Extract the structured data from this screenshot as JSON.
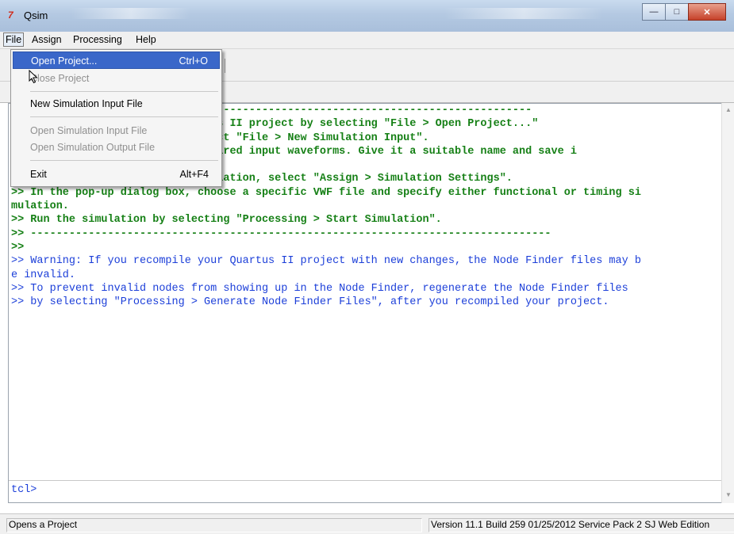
{
  "window": {
    "title": "Qsim",
    "app_icon_glyph": "7",
    "minimize_glyph": "—",
    "maximize_glyph": "□",
    "close_glyph": "✕"
  },
  "menubar": {
    "items": [
      {
        "label": "File"
      },
      {
        "label": "Assign"
      },
      {
        "label": "Processing"
      },
      {
        "label": "Help"
      }
    ]
  },
  "file_menu": {
    "items": [
      {
        "label": "Open Project...",
        "shortcut": "Ctrl+O",
        "state": "highlighted"
      },
      {
        "label": "Close Project",
        "shortcut": "",
        "state": "disabled"
      },
      {
        "label": "New Simulation Input File",
        "shortcut": "",
        "state": "enabled"
      },
      {
        "label": "Open Simulation Input File",
        "shortcut": "",
        "state": "disabled"
      },
      {
        "label": "Open Simulation Output File",
        "shortcut": "",
        "state": "disabled"
      },
      {
        "label": "Exit",
        "shortcut": "Alt+F4",
        "state": "enabled"
      }
    ]
  },
  "console": {
    "lines": [
      {
        "text": "                  ---------------------------------------------------------------",
        "color": "green"
      },
      {
        "text": "                  xisting Quartus II project by selecting \"File > Open Project...\"",
        "color": "green"
      },
      {
        "text": "                  orm file, select \"File > New Simulation Input\".",
        "color": "green"
      },
      {
        "text": "                  create the desired input waveforms. Give it a suitable name and save i",
        "color": "green"
      },
      {
        "text": "",
        "color": "green"
      },
      {
        "text": ">> To specify a setting for simulation, select \"Assign > Simulation Settings\".",
        "color": "green"
      },
      {
        "text": ">> In the pop-up dialog box, choose a specific VWF file and specify either functional or timing si",
        "color": "green"
      },
      {
        "text": "mulation.",
        "color": "green"
      },
      {
        "text": ">> Run the simulation by selecting \"Processing > Start Simulation\".",
        "color": "green"
      },
      {
        "text": ">> ---------------------------------------------------------------------------------",
        "color": "green"
      },
      {
        "text": ">>",
        "color": "green"
      },
      {
        "text": ">> Warning: If you recompile your Quartus II project with new changes, the Node Finder files may b",
        "color": "blue"
      },
      {
        "text": "e invalid.",
        "color": "blue"
      },
      {
        "text": ">> To prevent invalid nodes from showing up in the Node Finder, regenerate the Node Finder files",
        "color": "blue"
      },
      {
        "text": ">> by selecting \"Processing > Generate Node Finder Files\", after you recompiled your project.",
        "color": "blue"
      }
    ],
    "prompt": "tcl>"
  },
  "statusbar": {
    "message": "Opens a Project",
    "version": "Version 11.1 Build 259 01/25/2012 Service Pack 2 SJ Web Edition"
  },
  "colors": {
    "console_green": "#168016",
    "console_blue": "#1c3fd9",
    "menu_highlight": "#3a67c9"
  }
}
